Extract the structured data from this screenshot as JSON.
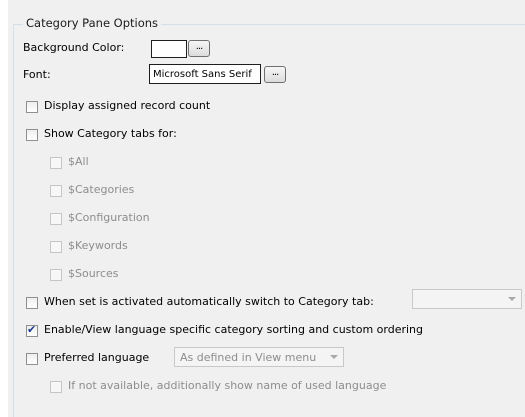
{
  "group": {
    "title": "Category Pane Options"
  },
  "background_color": {
    "label": "Background Color:",
    "value_color": "#ffffff",
    "button_label": "..."
  },
  "font": {
    "label": "Font:",
    "value": "Microsoft Sans Serif",
    "button_label": "..."
  },
  "options": {
    "display_count": {
      "label": "Display assigned record count",
      "checked": false
    },
    "show_tabs": {
      "label": "Show Category tabs for:",
      "checked": false
    },
    "tabs": [
      {
        "label": "$All",
        "checked": false,
        "enabled": false
      },
      {
        "label": "$Categories",
        "checked": false,
        "enabled": false
      },
      {
        "label": "$Configuration",
        "checked": false,
        "enabled": false
      },
      {
        "label": "$Keywords",
        "checked": false,
        "enabled": false
      },
      {
        "label": "$Sources",
        "checked": false,
        "enabled": false
      }
    ],
    "auto_switch": {
      "label": "When set is activated automatically switch to Category tab:",
      "checked": false,
      "select_value": ""
    },
    "language_sorting": {
      "label": "Enable/View language specific category sorting and custom ordering",
      "checked": true
    },
    "preferred_language": {
      "label": "Preferred language",
      "checked": false,
      "select_value": "As defined in View menu"
    },
    "fallback_language": {
      "label": "If not available, additionally show name of used language",
      "checked": false,
      "enabled": false
    }
  },
  "colors": {
    "panel_bg": "#f0f0f0",
    "check_mark": "#1f3a93",
    "disabled_text": "#8d8d8d"
  }
}
